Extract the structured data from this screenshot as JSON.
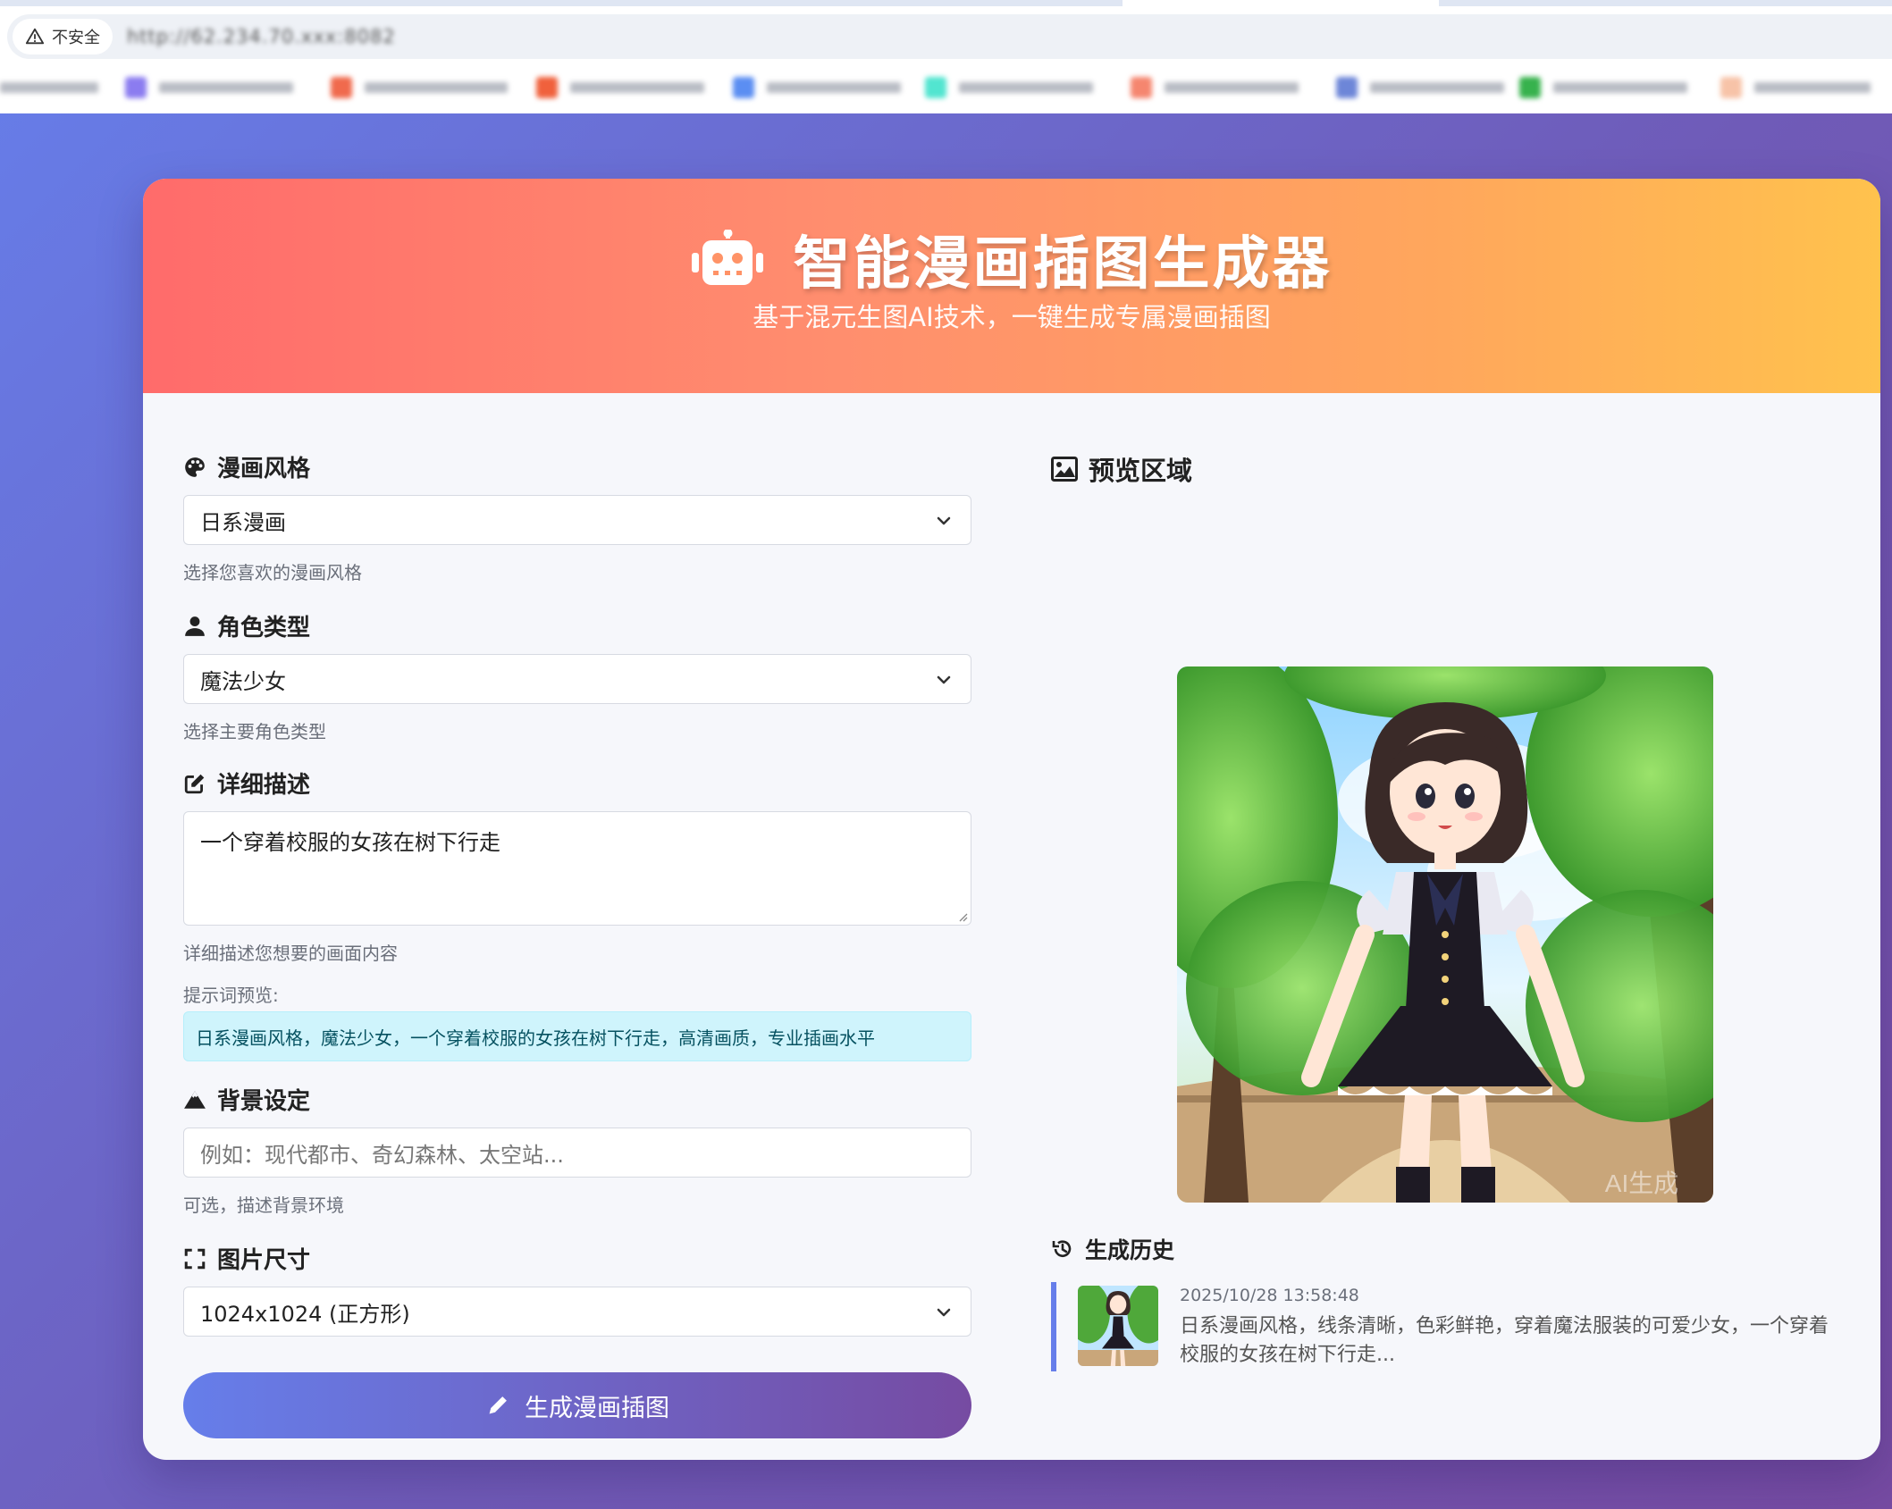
{
  "browser": {
    "security_label": "不安全",
    "url": "http://62.234.70.xxx:8082",
    "bookmarks_count_note": ""
  },
  "hero": {
    "icon": "robot-icon",
    "title": "智能漫画插图生成器",
    "subtitle": "基于混元生图AI技术，一键生成专属漫画插图"
  },
  "form": {
    "style": {
      "label": "漫画风格",
      "icon": "palette-icon",
      "value": "日系漫画",
      "help": "选择您喜欢的漫画风格"
    },
    "character": {
      "label": "角色类型",
      "icon": "user-icon",
      "value": "魔法少女",
      "help": "选择主要角色类型"
    },
    "description": {
      "label": "详细描述",
      "icon": "edit-icon",
      "value": "一个穿着校服的女孩在树下行走",
      "help": "详细描述您想要的画面内容"
    },
    "prompt_preview": {
      "label": "提示词预览:",
      "text": "日系漫画风格，魔法少女，一个穿着校服的女孩在树下行走，高清画质，专业插画水平"
    },
    "background": {
      "label": "背景设定",
      "icon": "mountain-icon",
      "placeholder": "例如：现代都市、奇幻森林、太空站...",
      "help": "可选，描述背景环境"
    },
    "size": {
      "label": "图片尺寸",
      "icon": "expand-icon",
      "value": "1024x1024 (正方形)"
    },
    "submit_label": "生成漫画插图"
  },
  "preview": {
    "title": "预览区域",
    "icon": "image-icon",
    "watermark": "AI生成"
  },
  "history": {
    "title": "生成历史",
    "icon": "history-icon",
    "items": [
      {
        "time": "2025/10/28 13:58:48",
        "desc": "日系漫画风格，线条清晰，色彩鲜艳，穿着魔法服装的可爱少女，一个穿着校服的女孩在树下行走..."
      }
    ]
  },
  "colors": {
    "page_gradient_start": "#667eea",
    "page_gradient_end": "#764ba2",
    "hero_gradient_start": "#ff6b6b",
    "hero_gradient_end": "#ffc24d",
    "info_bg": "#cff4fc",
    "info_text": "#055160"
  }
}
